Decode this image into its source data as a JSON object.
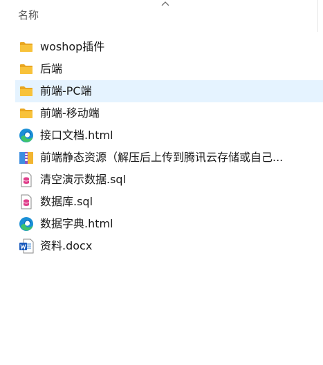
{
  "header": {
    "name_column": "名称",
    "sort_icon": "chevron-up-icon"
  },
  "files": [
    {
      "name": "woshop插件",
      "icon": "folder-icon",
      "selected": false
    },
    {
      "name": "后端",
      "icon": "folder-icon",
      "selected": false
    },
    {
      "name": "前端-PC端",
      "icon": "folder-icon",
      "selected": true
    },
    {
      "name": "前端-移动端",
      "icon": "folder-icon",
      "selected": false
    },
    {
      "name": "接口文档.html",
      "icon": "edge-html-icon",
      "selected": false
    },
    {
      "name": "前端静态资源（解压后上传到腾讯云存储或自己...",
      "icon": "archive-icon",
      "selected": false
    },
    {
      "name": "清空演示数据.sql",
      "icon": "sql-file-icon",
      "selected": false
    },
    {
      "name": "数据库.sql",
      "icon": "sql-file-icon",
      "selected": false
    },
    {
      "name": "数据字典.html",
      "icon": "edge-html-icon",
      "selected": false
    },
    {
      "name": "资料.docx",
      "icon": "word-doc-icon",
      "selected": false
    }
  ],
  "colors": {
    "selection": "#e5f3ff",
    "folder": "#f8c23a",
    "header_text": "#5f5f5f"
  }
}
